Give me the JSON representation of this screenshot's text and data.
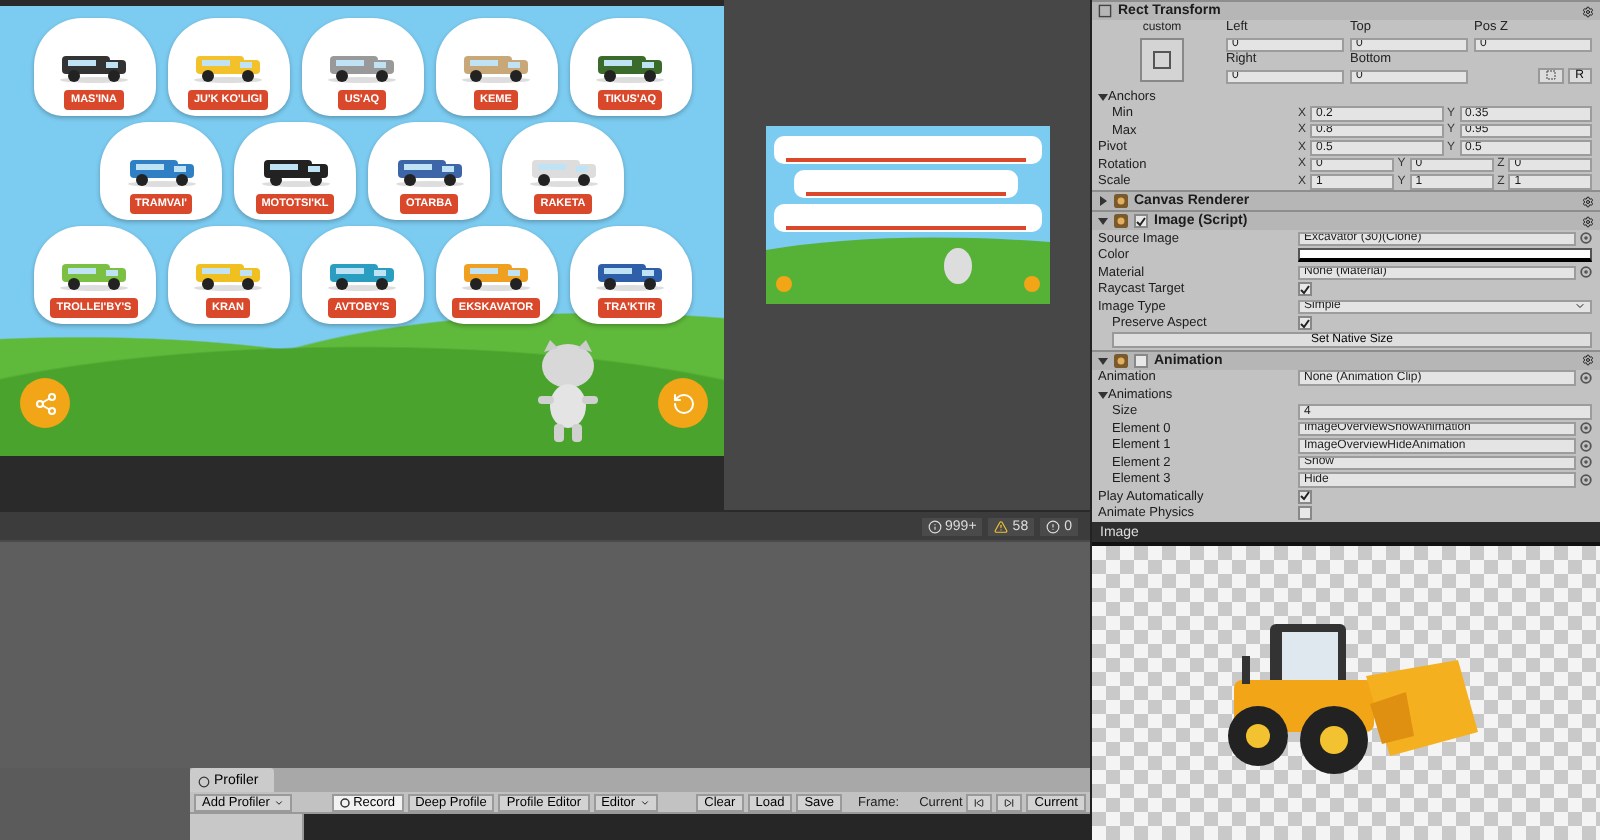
{
  "game_view": {
    "rows": [
      {
        "items": [
          {
            "label": "MAS'INA"
          },
          {
            "label": "JU'K KO'LIGI"
          },
          {
            "label": "US'AQ"
          },
          {
            "label": "KEME"
          },
          {
            "label": "TIKUS'AQ"
          }
        ]
      },
      {
        "items": [
          {
            "label": "TRAMVAI'"
          },
          {
            "label": "MOTOTSI'KL"
          },
          {
            "label": "OTARBA"
          },
          {
            "label": "RAKETA"
          }
        ]
      },
      {
        "items": [
          {
            "label": "TROLLEI'BY'S"
          },
          {
            "label": "KRAN"
          },
          {
            "label": "AVTOBY'S"
          },
          {
            "label": "EKSKAVATOR"
          },
          {
            "label": "TRA'KTIR"
          }
        ]
      }
    ]
  },
  "console_counts": {
    "info": "999+",
    "warnings": "58",
    "errors": "0"
  },
  "profiler": {
    "tab": "Profiler",
    "add_profiler": "Add Profiler",
    "toolbar": [
      {
        "label": "Record",
        "kind": "record",
        "selected": true
      },
      {
        "label": "Deep Profile",
        "kind": "button",
        "selected": false
      },
      {
        "label": "Profile Editor",
        "kind": "button",
        "selected": false
      },
      {
        "label": "Editor",
        "kind": "dropdown",
        "selected": false
      }
    ],
    "file_buttons": [
      "Clear",
      "Load",
      "Save"
    ],
    "frame_label": "Frame:",
    "frame_value": "Current",
    "current_button": "Current"
  },
  "inspector": {
    "rect_transform": {
      "title": "Rect Transform",
      "preset": "custom",
      "offsets": [
        {
          "label": "Left",
          "value": "0"
        },
        {
          "label": "Top",
          "value": "0"
        },
        {
          "label": "Pos Z",
          "value": "0"
        },
        {
          "label": "Right",
          "value": "0"
        },
        {
          "label": "Bottom",
          "value": "0"
        }
      ],
      "raw_button": "R",
      "fields": [
        {
          "kind": "foldout",
          "label": "Anchors",
          "expanded": true,
          "children": [
            {
              "kind": "vector",
              "label": "Min",
              "values": [
                {
                  "axis": "X",
                  "value": "0.2"
                },
                {
                  "axis": "Y",
                  "value": "0.35"
                }
              ]
            },
            {
              "kind": "vector",
              "label": "Max",
              "values": [
                {
                  "axis": "X",
                  "value": "0.8"
                },
                {
                  "axis": "Y",
                  "value": "0.95"
                }
              ]
            }
          ]
        },
        {
          "kind": "vector",
          "label": "Pivot",
          "values": [
            {
              "axis": "X",
              "value": "0.5"
            },
            {
              "axis": "Y",
              "value": "0.5"
            }
          ]
        },
        {
          "kind": "vector",
          "label": "Rotation",
          "values": [
            {
              "axis": "X",
              "value": "0"
            },
            {
              "axis": "Y",
              "value": "0"
            },
            {
              "axis": "Z",
              "value": "0"
            }
          ]
        },
        {
          "kind": "vector",
          "label": "Scale",
          "values": [
            {
              "axis": "X",
              "value": "1"
            },
            {
              "axis": "Y",
              "value": "1"
            },
            {
              "axis": "Z",
              "value": "1"
            }
          ]
        }
      ]
    },
    "components": [
      {
        "title": "Canvas Renderer",
        "kind": "plain",
        "expanded": false
      },
      {
        "title": "Image (Script)",
        "kind": "toggle",
        "enabled": true,
        "expanded": true,
        "fields": [
          {
            "kind": "object",
            "label": "Source Image",
            "value": "Excavator (30)(Clone)"
          },
          {
            "kind": "color",
            "label": "Color",
            "color": "#ffffff"
          },
          {
            "kind": "object",
            "label": "Material",
            "value": "None (Material)"
          },
          {
            "kind": "checkbox",
            "label": "Raycast Target",
            "checked": true
          },
          {
            "kind": "dropdown",
            "label": "Image Type",
            "value": "Simple",
            "children": [
              {
                "kind": "checkbox",
                "label": "Preserve Aspect",
                "checked": true
              },
              {
                "kind": "button",
                "label": "Set Native Size"
              }
            ]
          }
        ]
      },
      {
        "title": "Animation",
        "kind": "toggle",
        "enabled": false,
        "expanded": true,
        "fields": [
          {
            "kind": "object",
            "label": "Animation",
            "value": "None (Animation Clip)"
          },
          {
            "kind": "foldout",
            "label": "Animations",
            "expanded": true,
            "children": [
              {
                "kind": "text",
                "label": "Size",
                "value": "4"
              },
              {
                "kind": "object",
                "label": "Element 0",
                "value": "ImageOverviewShowAnimation"
              },
              {
                "kind": "object",
                "label": "Element 1",
                "value": "ImageOverviewHideAnimation"
              },
              {
                "kind": "object",
                "label": "Element 2",
                "value": "Show"
              },
              {
                "kind": "object",
                "label": "Element 3",
                "value": "Hide"
              }
            ]
          },
          {
            "kind": "checkbox",
            "label": "Play Automatically",
            "checked": true
          },
          {
            "kind": "checkbox",
            "label": "Animate Physics",
            "checked": false
          }
        ]
      }
    ]
  },
  "image_preview": {
    "title": "Image"
  }
}
